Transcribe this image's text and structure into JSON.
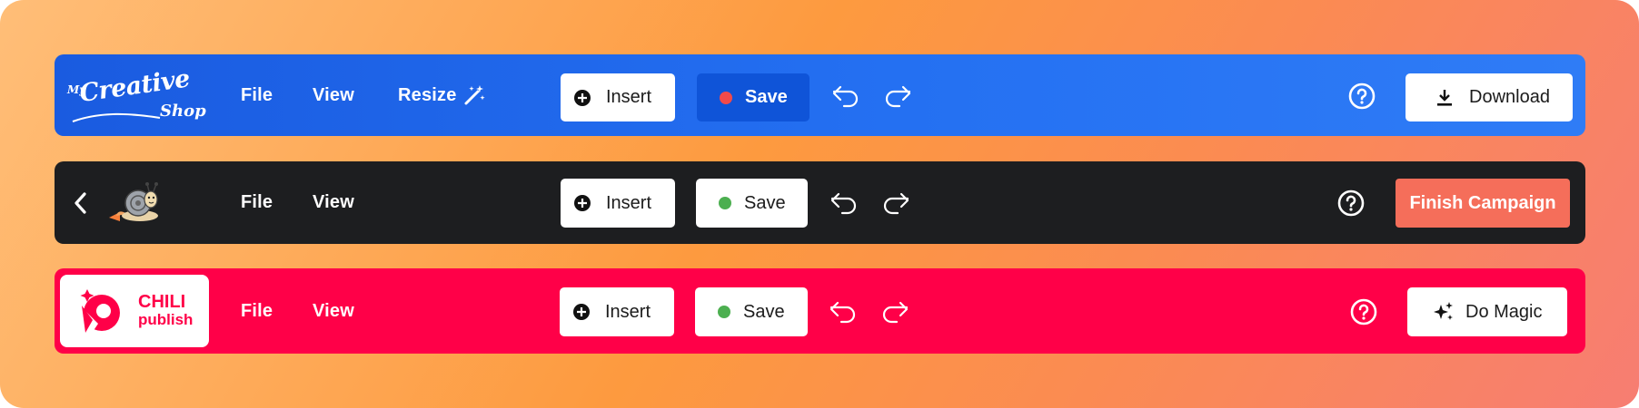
{
  "toolbars": [
    {
      "brand": {
        "line1": "My",
        "line2": "Creative",
        "line3": "Shop"
      },
      "menu": {
        "file": "File",
        "view": "View",
        "resize": "Resize"
      },
      "insert_label": "Insert",
      "save_label": "Save",
      "save_status_color": "#f24a4a",
      "cta_label": "Download",
      "bar_color": "#2470f2"
    },
    {
      "menu": {
        "file": "File",
        "view": "View"
      },
      "insert_label": "Insert",
      "save_label": "Save",
      "save_status_color": "#4caf50",
      "cta_label": "Finish Campaign",
      "cta_color": "#f56e5a",
      "bar_color": "#1d1e20"
    },
    {
      "brand": {
        "line1": "CHILI",
        "line2": "publish"
      },
      "menu": {
        "file": "File",
        "view": "View"
      },
      "insert_label": "Insert",
      "save_label": "Save",
      "save_status_color": "#4caf50",
      "cta_label": "Do Magic",
      "bar_color": "#ff0048"
    }
  ],
  "icons": [
    "magic-wand-icon",
    "plus-circle-icon",
    "undo-icon",
    "redo-icon",
    "help-icon",
    "download-icon",
    "back-chevron-icon",
    "snail-mascot-icon",
    "sparkles-icon",
    "chili-publish-logo-icon"
  ]
}
